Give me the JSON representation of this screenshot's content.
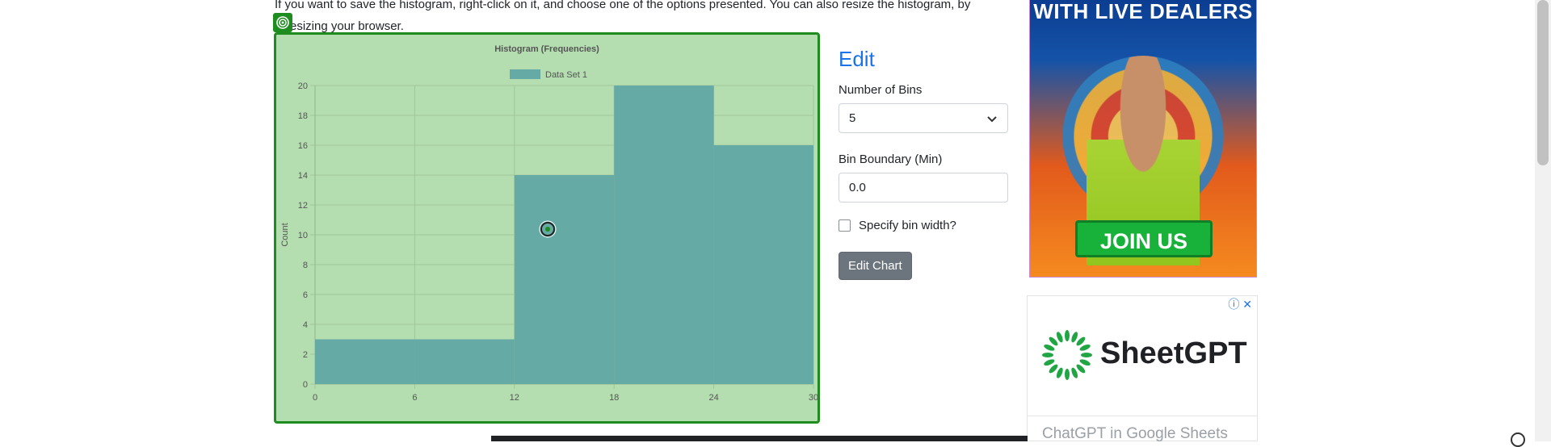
{
  "intro": {
    "line1": "If you want to save the histogram, right-click on it, and choose one of the options presented. You can also resize the histogram, by",
    "line2": "resizing your browser."
  },
  "chart_data": {
    "type": "bar",
    "title": "Histogram (Frequencies)",
    "legend": [
      "Data Set 1"
    ],
    "legend_position": "top",
    "xlabel": "",
    "ylabel": "Count",
    "bin_edges": [
      0,
      6,
      12,
      18,
      24,
      30
    ],
    "x_ticks": [
      "0",
      "6",
      "12",
      "18",
      "24",
      "30"
    ],
    "y_ticks": [
      "0",
      "2",
      "4",
      "6",
      "8",
      "10",
      "12",
      "14",
      "16",
      "18",
      "20"
    ],
    "series": [
      {
        "name": "Data Set 1",
        "values": [
          3,
          3,
          14,
          20,
          16
        ]
      }
    ],
    "xlim": [
      0,
      30
    ],
    "ylim": [
      0,
      20
    ],
    "grid": true,
    "colors": {
      "bar": "#66aaa5",
      "background": "#b4ddb0",
      "border": "#1e8c1e"
    }
  },
  "edit": {
    "title": "Edit",
    "bins_label": "Number of Bins",
    "bins_value": "5",
    "boundary_label": "Bin Boundary (Min)",
    "boundary_value": "0.0",
    "bin_width_label": "Specify bin width?",
    "button_label": "Edit Chart"
  },
  "ads": {
    "ad1_headline": "WITH LIVE DEALERS",
    "ad1_cta": "JOIN US",
    "ad2_brand": "SheetGPT",
    "ad2_tagline": "ChatGPT in Google Sheets"
  },
  "icons": {
    "chart_badge": "target-icon",
    "cursor": "crosshair-target-icon",
    "select_arrow": "chevron-down-icon",
    "ad_info": "info-icon",
    "ad_close": "close-icon"
  }
}
